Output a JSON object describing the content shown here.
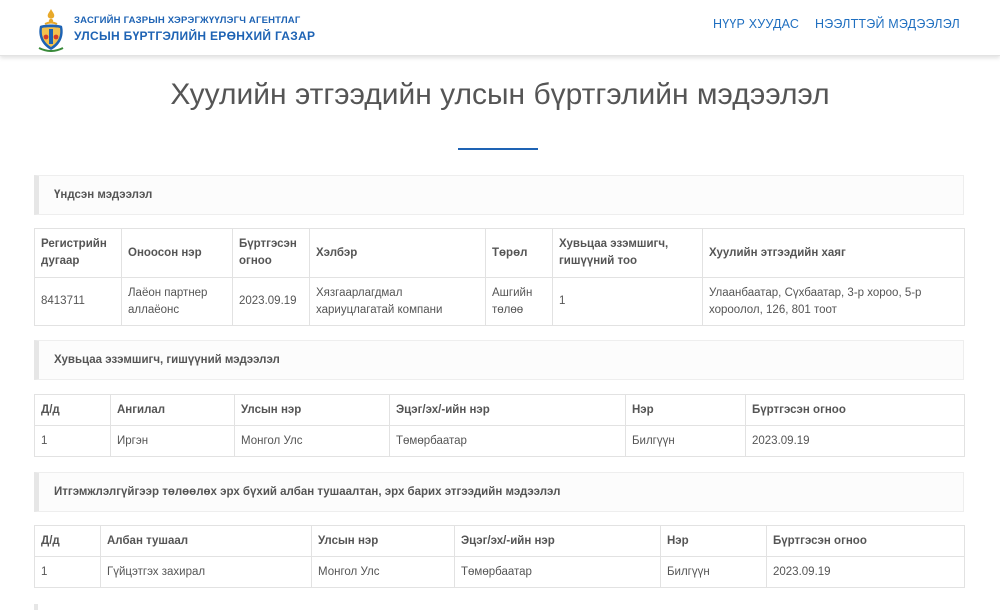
{
  "header": {
    "agency_line1": "ЗАСГИЙН ГАЗРЫН ХЭРЭГЖҮҮЛЭГЧ АГЕНТЛАГ",
    "agency_line2": "УЛСЫН БҮРТГЭЛИЙН ЕРӨНХИЙ ГАЗАР",
    "nav": {
      "home": "НҮҮР ХУУДАС",
      "open_info": "НЭЭЛТТЭЙ МЭДЭЭЛЭЛ"
    },
    "brand_color": "#1e63b4",
    "logo_icon": "soyombo-emblem-icon"
  },
  "page": {
    "title": "Хуулийн этгээдийн улсын бүртгэлийн мэдээлэл"
  },
  "basic_info": {
    "section_title": "Үндсэн мэдээлэл",
    "headers": [
      "Регистрийн дугаар",
      "Оноосон нэр",
      "Бүртгэсэн огноо",
      "Хэлбэр",
      "Төрөл",
      "Хувьцаа эзэмшигч, гишүүний тоо",
      "Хуулийн этгээдийн хаяг"
    ],
    "rows": [
      [
        "8413711",
        "Лаёон партнер аллаёонс",
        "2023.09.19",
        "Хязгаарлагдмал хариуцлагатай компани",
        "Ашгийн төлөө",
        "1",
        "Улаанбаатар, Сүхбаатар, 3-р хороо, 5-р хороолол, 126, 801 тоот"
      ]
    ]
  },
  "shareholders": {
    "section_title": "Хувьцаа эзэмшигч, гишүүний мэдээлэл",
    "headers": [
      "Д/д",
      "Ангилал",
      "Улсын нэр",
      "Эцэг/эх/-ийн нэр",
      "Нэр",
      "Бүртгэсэн огноо"
    ],
    "rows": [
      [
        "1",
        "Иргэн",
        "Монгол Улс",
        "Төмөрбаатар",
        "Билгүүн",
        "2023.09.19"
      ]
    ]
  },
  "officials": {
    "section_title": "Итгэмжлэлгүйгээр төлөөлөх эрх бүхий албан тушаалтан, эрх барих этгээдийн мэдээлэл",
    "headers": [
      "Д/д",
      "Албан тушаал",
      "Улсын нэр",
      "Эцэг/эх/-ийн нэр",
      "Нэр",
      "Бүртгэсэн огноо"
    ],
    "rows": [
      [
        "1",
        "Гүйцэтгэх захирал",
        "Монгол Улс",
        "Төмөрбаатар",
        "Билгүүн",
        "2023.09.19"
      ]
    ]
  }
}
